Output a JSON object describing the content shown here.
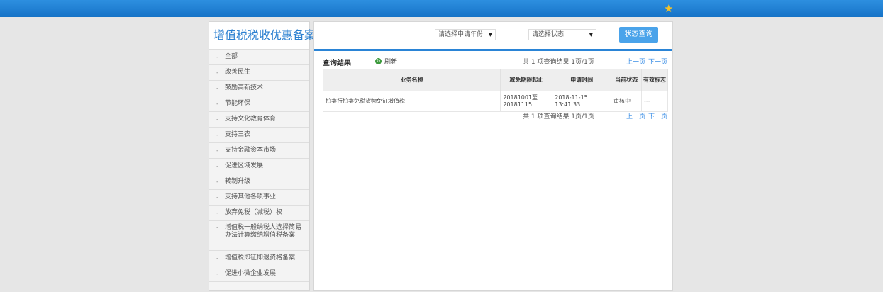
{
  "topbar": {
    "star_icon": "star-icon",
    "star_color": "#f5c227"
  },
  "sidebar": {
    "title": "增值税税收优惠备案",
    "items": [
      {
        "label": "全部"
      },
      {
        "label": "改善民生"
      },
      {
        "label": "鼓励高新技术"
      },
      {
        "label": "节能环保"
      },
      {
        "label": "支持文化教育体育"
      },
      {
        "label": "支持三农"
      },
      {
        "label": "支持金融资本市场"
      },
      {
        "label": "促进区域发展"
      },
      {
        "label": "转制升级"
      },
      {
        "label": "支持其他各项事业"
      },
      {
        "label": "放弃免税（减税）权"
      },
      {
        "label": "增值税一般纳税人选择简易办法计算缴纳增值税备案"
      },
      {
        "label": "增值税即征即退资格备案"
      },
      {
        "label": "促进小微企业发展"
      }
    ],
    "dash": "-"
  },
  "filters": {
    "year_select": "请选择申请年份",
    "status_select": "请选择状态",
    "query_button": "状态查询"
  },
  "results": {
    "title": "查询结果",
    "refresh_label": "刷新",
    "summary": "共 1 项查询结果 1页/1页",
    "prev": "上一页",
    "next": "下一页",
    "columns": [
      "业务名称",
      "减免期限起止",
      "申请时间",
      "当前状态",
      "有效标志"
    ],
    "rows": [
      {
        "name": "拍卖行拍卖免税货物免征增值税",
        "period": "20181001至20181115",
        "applied": "2018-11-15 13:41:33",
        "status": "审核中",
        "flag": "---"
      }
    ]
  },
  "colors": {
    "accent": "#2a84d6",
    "button": "#4aa3ea",
    "title": "#2a7fd0"
  }
}
